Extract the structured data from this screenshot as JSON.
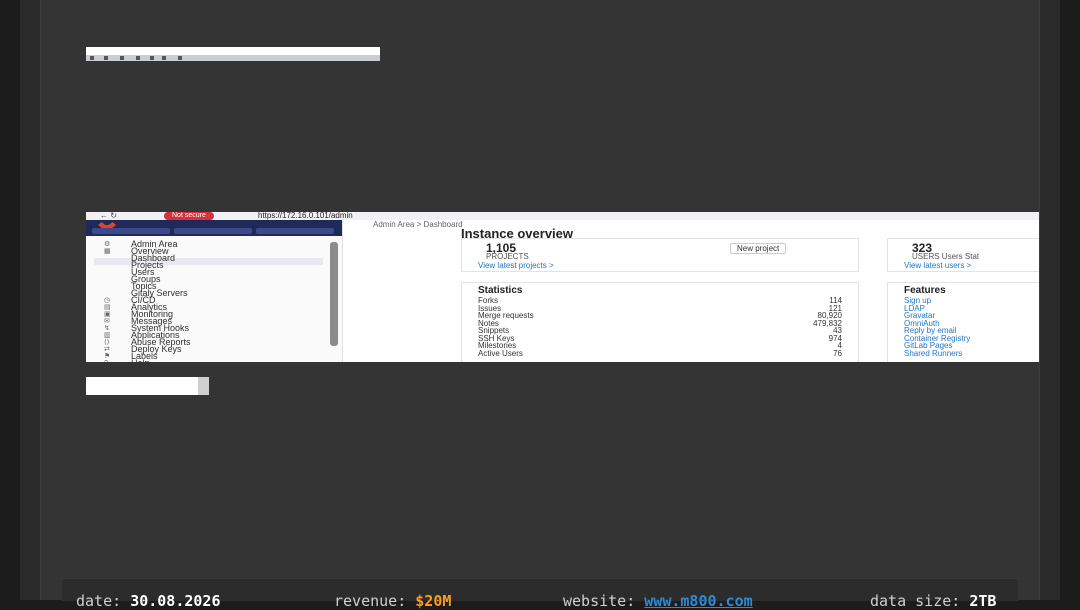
{
  "thumbnail_small": {
    "alt": "tiny browser screenshot"
  },
  "screenshot": {
    "topbar": {
      "nav_glyphs": "←  ↻",
      "badge": "Not secure",
      "url": "https://172.16.0.101/admin"
    },
    "sidebar": {
      "items": [
        {
          "icon": "⚙",
          "label": "Admin Area"
        },
        {
          "icon": "▦",
          "label": "Overview"
        },
        {
          "icon": "",
          "label": "Dashboard"
        },
        {
          "icon": "",
          "label": "Projects"
        },
        {
          "icon": "",
          "label": "Users"
        },
        {
          "icon": "",
          "label": "Groups"
        },
        {
          "icon": "",
          "label": "Topics"
        },
        {
          "icon": "",
          "label": "Gitaly Servers"
        },
        {
          "icon": "◷",
          "label": "CI/CD"
        },
        {
          "icon": "▤",
          "label": "Analytics"
        },
        {
          "icon": "▣",
          "label": "Monitoring"
        },
        {
          "icon": "✉",
          "label": "Messages"
        },
        {
          "icon": "↯",
          "label": "System Hooks"
        },
        {
          "icon": "▥",
          "label": "Applications"
        },
        {
          "icon": "⟨⟩",
          "label": "Abuse Reports"
        },
        {
          "icon": "⇄",
          "label": "Deploy Keys"
        },
        {
          "icon": "⚑",
          "label": "Labels"
        },
        {
          "icon": "?",
          "label": "Help"
        }
      ]
    },
    "main": {
      "breadcrumb": "Admin Area  >  Dashboard",
      "title": "Instance overview",
      "projects_count": "1,105",
      "projects_label": "PROJECTS",
      "new_project": "New project",
      "view_projects": "View latest projects  >",
      "users_count": "323",
      "users_label": "USERS  Users Stat",
      "view_users": "View latest users  >",
      "statistics_title": "Statistics",
      "statistics": [
        {
          "label": "Forks",
          "value": "114"
        },
        {
          "label": "Issues",
          "value": "121"
        },
        {
          "label": "Merge requests",
          "value": "80,920"
        },
        {
          "label": "Notes",
          "value": "479,832"
        },
        {
          "label": "Snippets",
          "value": "43"
        },
        {
          "label": "SSH Keys",
          "value": "974"
        },
        {
          "label": "Milestones",
          "value": "4"
        },
        {
          "label": "Active Users",
          "value": "76"
        }
      ],
      "features_title": "Features",
      "features": [
        "Sign up",
        "LDAP",
        "Gravatar",
        "OmniAuth",
        "Reply by email",
        "Container Registry",
        "GitLab Pages",
        "Shared Runners"
      ]
    }
  },
  "footer": {
    "date_key": "date:",
    "date_value": "30.08.2026",
    "revenue_key": "revenue:",
    "revenue_value": "$20M",
    "website_key": "website:",
    "website_value": "www.m800.com",
    "data_size_key": "data size:",
    "data_size_value": "2TB"
  },
  "colors": {
    "background": "#343434",
    "revenue": "#ff9a1a",
    "website": "#2b8cd6",
    "badge": "#d6323b"
  }
}
